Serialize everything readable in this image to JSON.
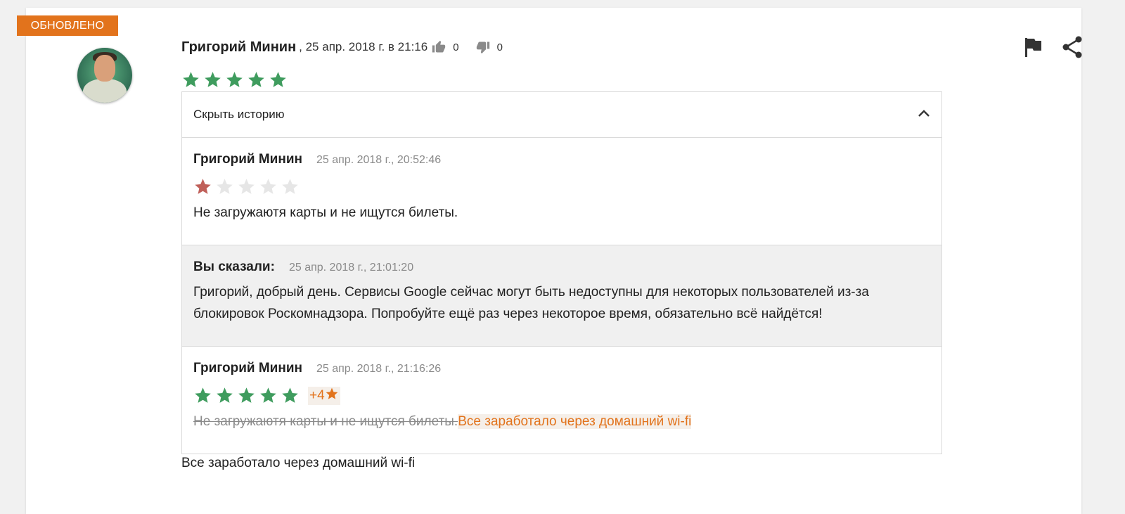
{
  "review": {
    "badge": "ОБНОВЛЕНО",
    "author": "Григорий Минин",
    "date": ", 25 апр. 2018 г. в 21:16",
    "likes": "0",
    "dislikes": "0",
    "rating": 5,
    "final_text": "Все заработало через домашний wi-fi"
  },
  "history": {
    "toggle_label": "Скрыть историю",
    "entries": [
      {
        "author": "Григорий Минин",
        "date": "25 апр. 2018 г., 20:52:46",
        "rating": 1,
        "text": "Не загружаютя карты и не ищутся билеты."
      },
      {
        "author": "Вы сказали:",
        "date": "25 апр. 2018 г., 21:01:20",
        "text": "Григорий, добрый день. Сервисы Google сейчас могут быть недоступны для некоторых пользователей из-за блокировок Роскомнадзора. Попробуйте ещё раз через некоторое время, обязательно всё найдётся!"
      },
      {
        "author": "Григорий Минин",
        "date": "25 апр. 2018 г., 21:16:26",
        "rating": 5,
        "rating_delta": "+4",
        "old_text": "Не загружаютя карты и не ищутся билеты.",
        "new_text": "Все заработало через домашний wi-fi"
      }
    ]
  },
  "icons": {
    "like": "thumb-up-icon",
    "dislike": "thumb-down-icon",
    "flag": "flag-icon",
    "share": "share-icon",
    "collapse": "chevron-up-icon",
    "star": "star-icon"
  },
  "colors": {
    "badge": "#e2731c",
    "star_green": "#3f9c5e",
    "star_red": "#c0605a",
    "star_empty": "#e6e6e6",
    "delta_orange": "#e2731c"
  }
}
